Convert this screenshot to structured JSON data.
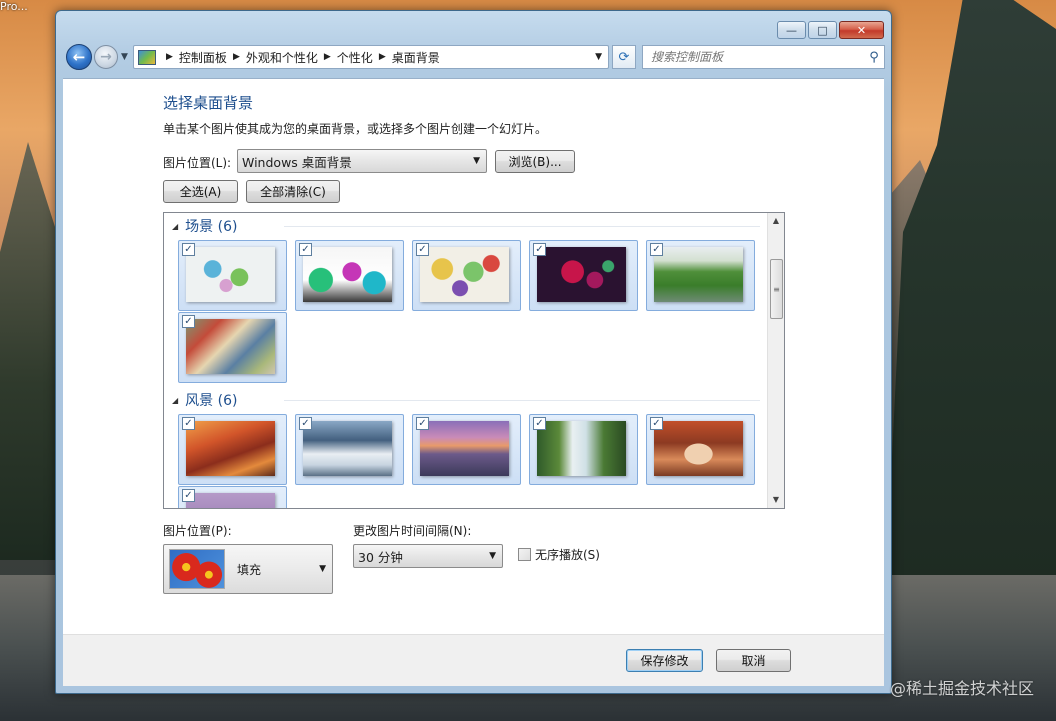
{
  "desktop": {
    "corner_label": "Pro...",
    "watermark": "@稀土掘金技术社区"
  },
  "window": {
    "caption": {
      "minimize": "—",
      "maximize": "□",
      "close": "✕"
    },
    "nav": {
      "back_icon": "arrow-left-icon",
      "forward_icon": "arrow-right-icon",
      "breadcrumb": [
        "控制面板",
        "外观和个性化",
        "个性化",
        "桌面背景"
      ],
      "search_placeholder": "搜索控制面板"
    }
  },
  "main": {
    "title": "选择桌面背景",
    "subtitle": "单击某个图片使其成为您的桌面背景，或选择多个图片创建一个幻灯片。",
    "location_label": "图片位置(L):",
    "location_value": "Windows 桌面背景",
    "browse_label": "浏览(B)...",
    "select_all_label": "全选(A)",
    "clear_all_label": "全部清除(C)",
    "groups": [
      {
        "name": "场景 (6)",
        "checked_count": 6
      },
      {
        "name": "风景 (6)",
        "checked_count": 6
      }
    ],
    "position_label": "图片位置(P):",
    "position_value": "填充",
    "interval_label": "更改图片时间间隔(N):",
    "interval_value": "30 分钟",
    "shuffle_label": "无序播放(S)",
    "shuffle_checked": false
  },
  "footer": {
    "save_label": "保存修改",
    "cancel_label": "取消"
  }
}
